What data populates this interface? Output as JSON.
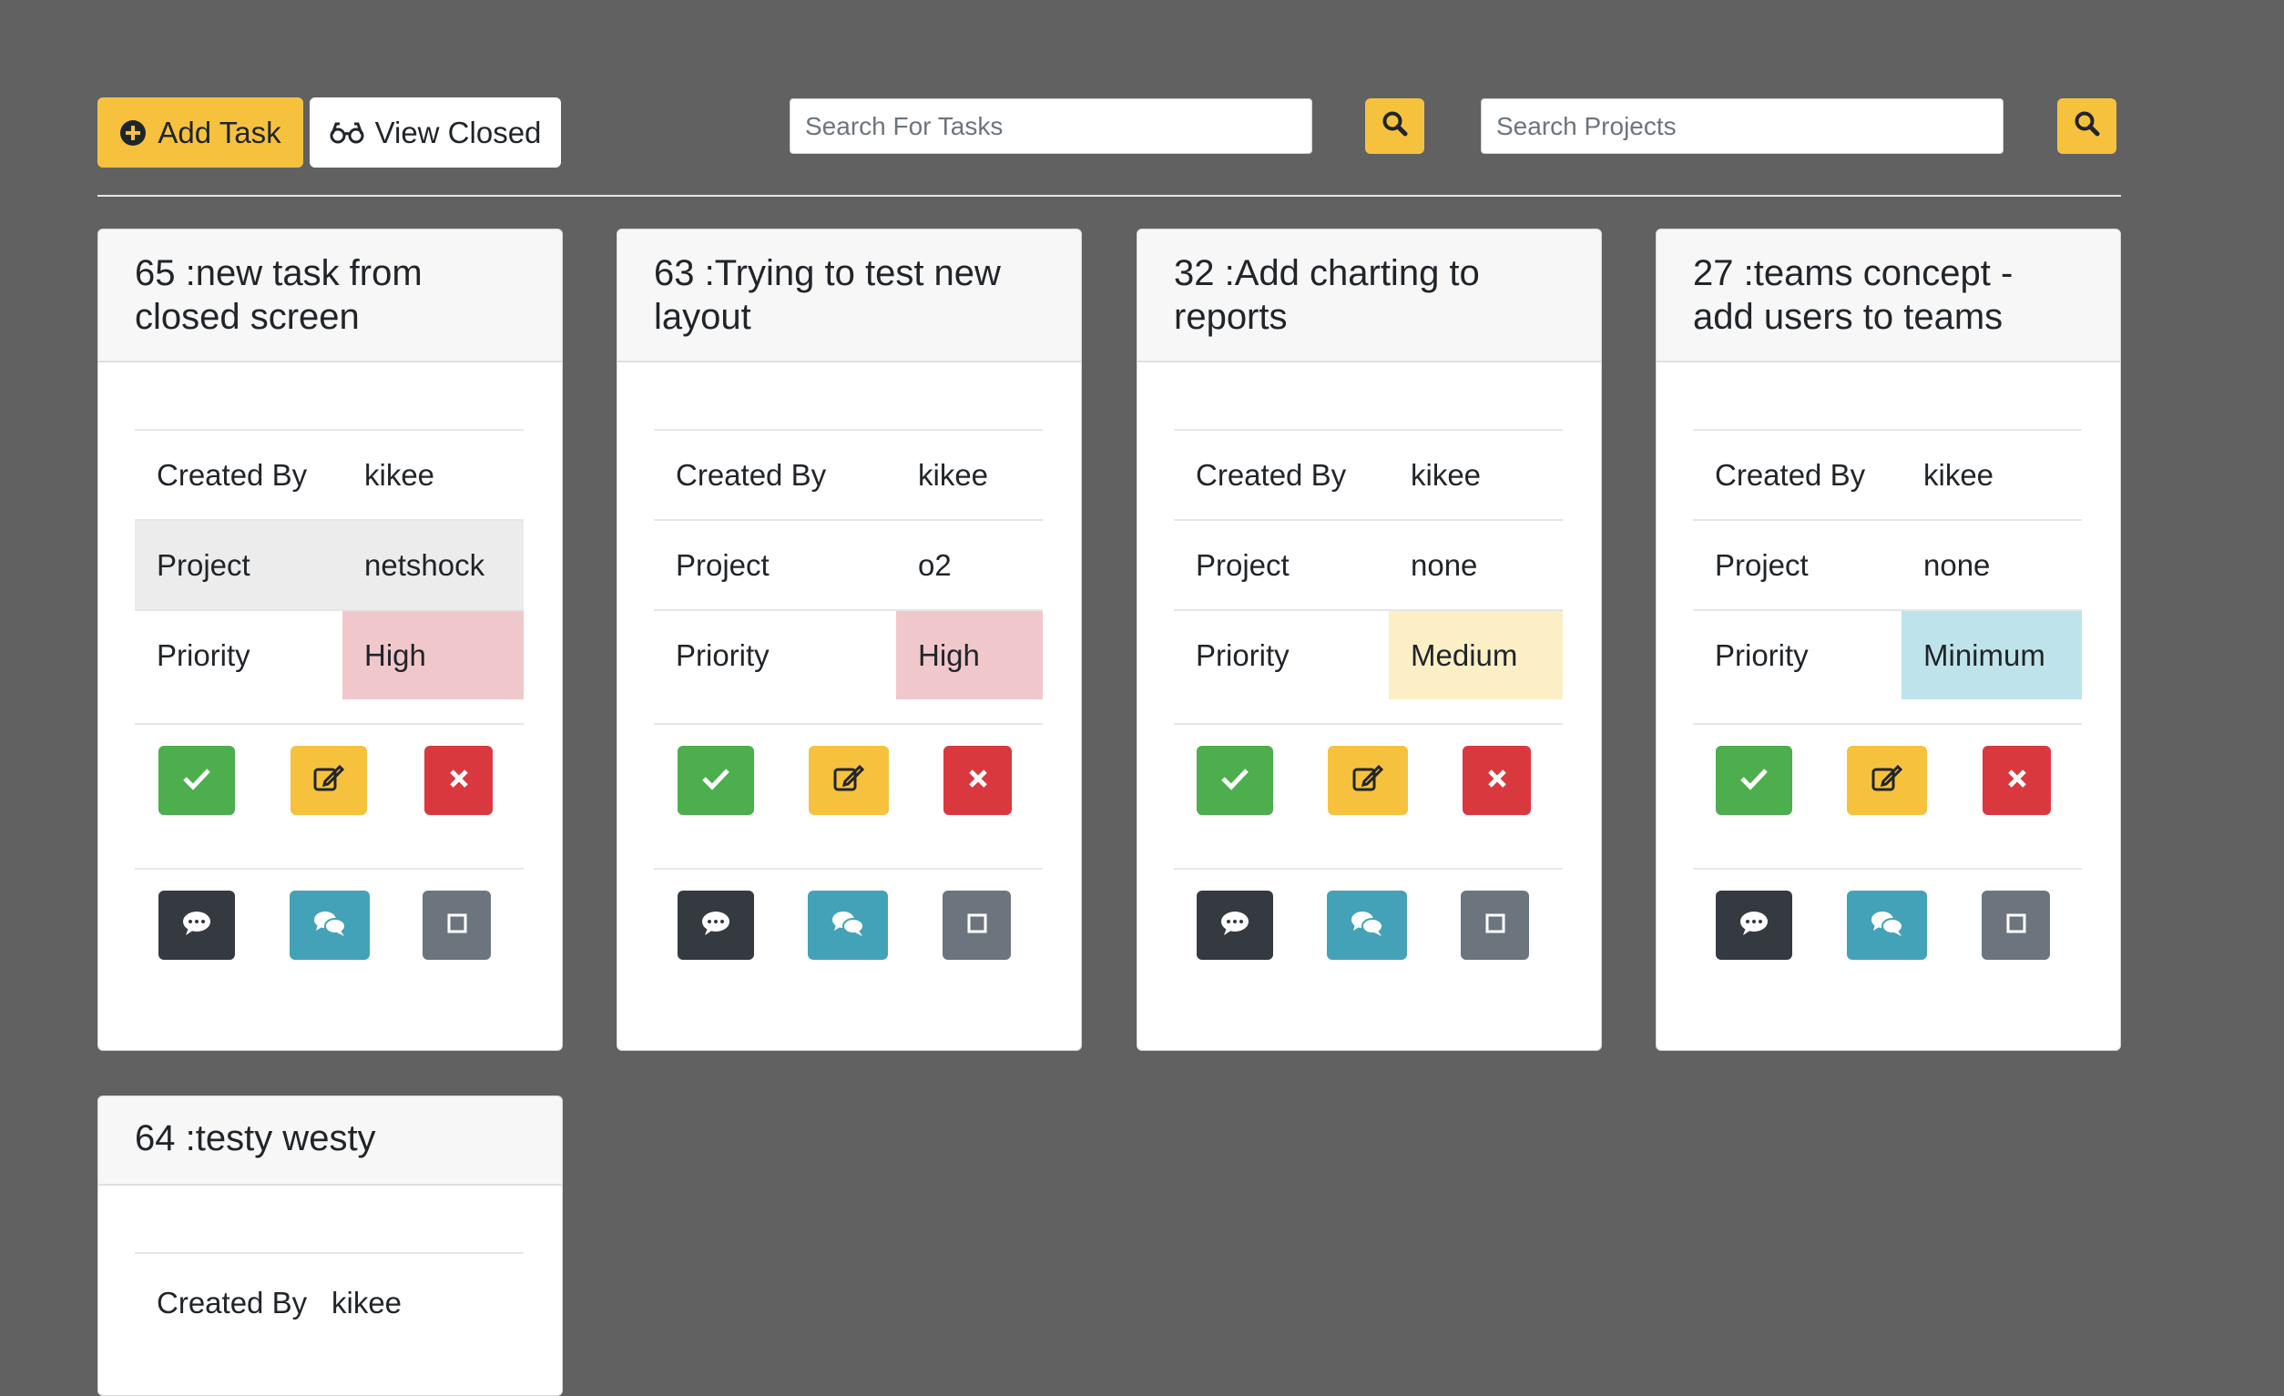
{
  "toolbar": {
    "add_task_label": "Add Task",
    "view_closed_label": "View Closed",
    "search_tasks_placeholder": "Search For Tasks",
    "search_projects_placeholder": "Search Projects"
  },
  "labels": {
    "created_by": "Created By",
    "project": "Project",
    "priority": "Priority"
  },
  "colors": {
    "high": "#f0c8cc",
    "medium": "#fdefc5",
    "minimum": "#bfe3ea",
    "accent": "#f6c23e"
  },
  "cards": [
    {
      "title": "65 :new task from closed screen",
      "created_by": "kikee",
      "project": "netshock",
      "priority": "High"
    },
    {
      "title": "63 :Trying to test new layout",
      "created_by": "kikee",
      "project": "o2",
      "priority": "High"
    },
    {
      "title": "32 :Add charting to reports",
      "created_by": "kikee",
      "project": "none",
      "priority": "Medium"
    },
    {
      "title": "27 :teams concept - add users to teams",
      "created_by": "kikee",
      "project": "none",
      "priority": "Minimum"
    },
    {
      "title": "64 :testy westy",
      "created_by": "kikee",
      "project": "",
      "priority": ""
    }
  ]
}
